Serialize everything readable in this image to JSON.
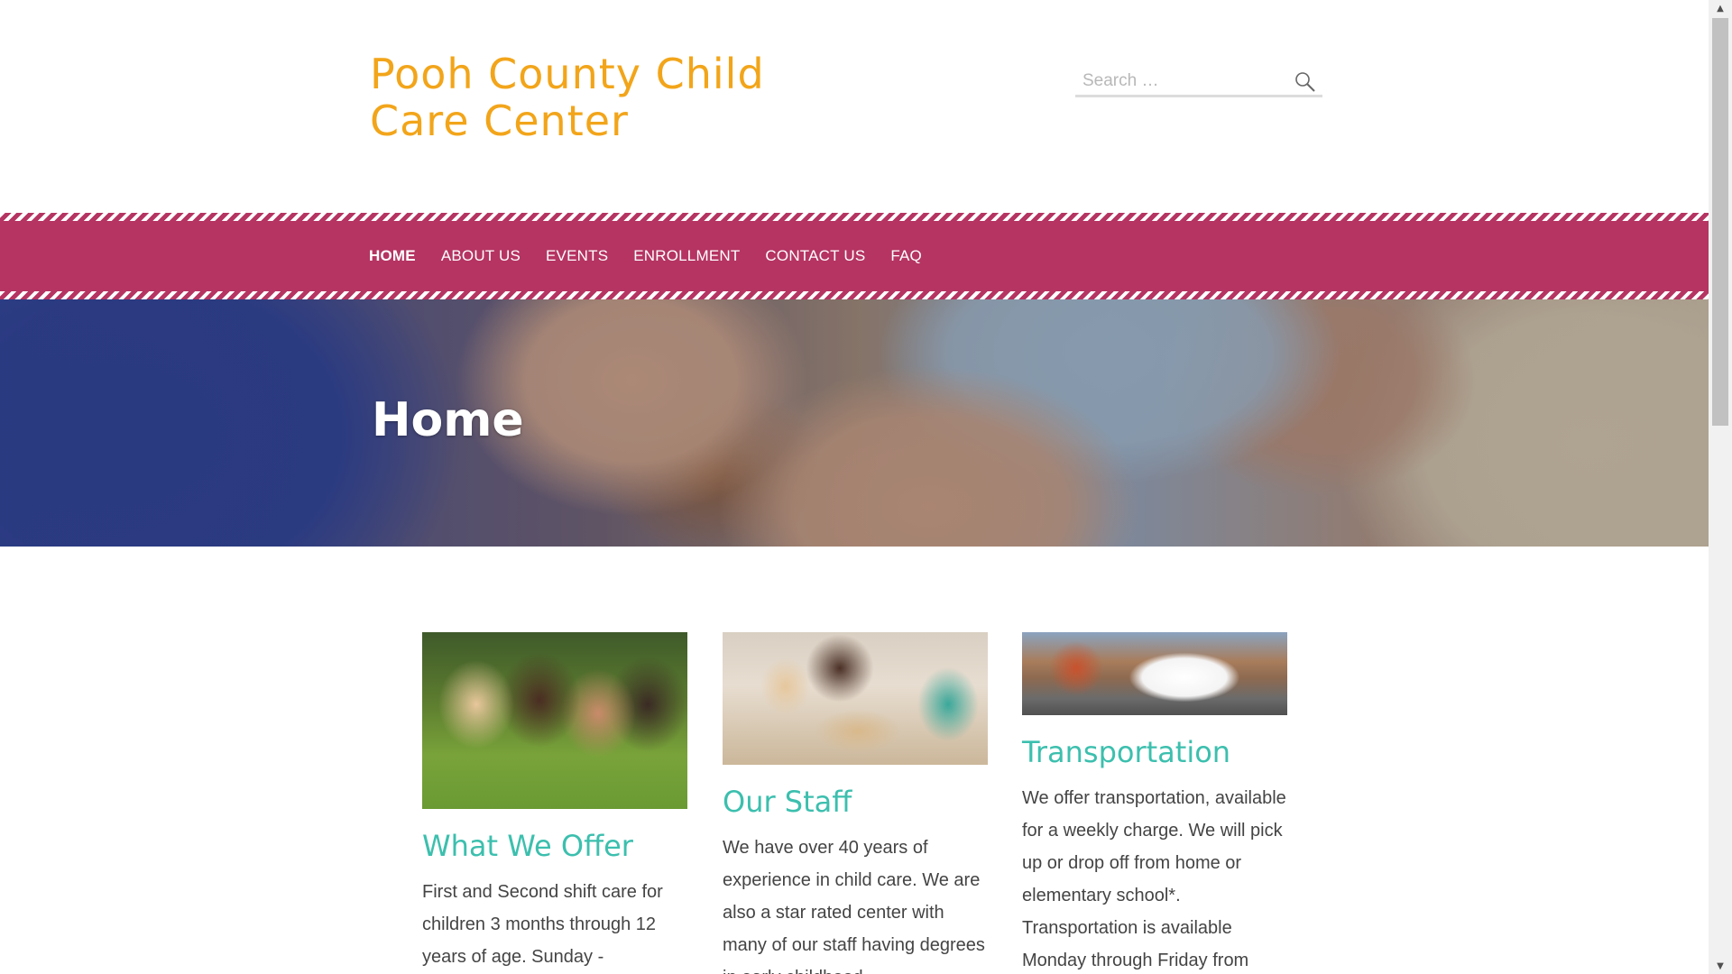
{
  "site": {
    "title": "Pooh County Child Care Center"
  },
  "search": {
    "placeholder": "Search …"
  },
  "nav": {
    "items": [
      {
        "label": "HOME",
        "active": true
      },
      {
        "label": "ABOUT US"
      },
      {
        "label": "EVENTS"
      },
      {
        "label": "ENROLLMENT"
      },
      {
        "label": "CONTACT US"
      },
      {
        "label": "FAQ"
      }
    ]
  },
  "hero": {
    "title": "Home"
  },
  "columns": [
    {
      "title": "What We Offer",
      "text": "First and Second shift care for children 3 months through 12 years of age. Sunday -"
    },
    {
      "title": "Our Staff",
      "text": "We have over 40 years of experience in child care. We are also a star rated center with many of our staff having degrees in early childhood"
    },
    {
      "title": "Transportation",
      "text": "We offer transportation, available for a weekly charge. We will pick up or drop off from home or elementary school*. Transportation is available Monday through Friday from"
    }
  ],
  "colors": {
    "title": "#f2a51a",
    "nav_bg": "#b53462",
    "heading": "#3cbfae",
    "body_text": "#444444"
  }
}
